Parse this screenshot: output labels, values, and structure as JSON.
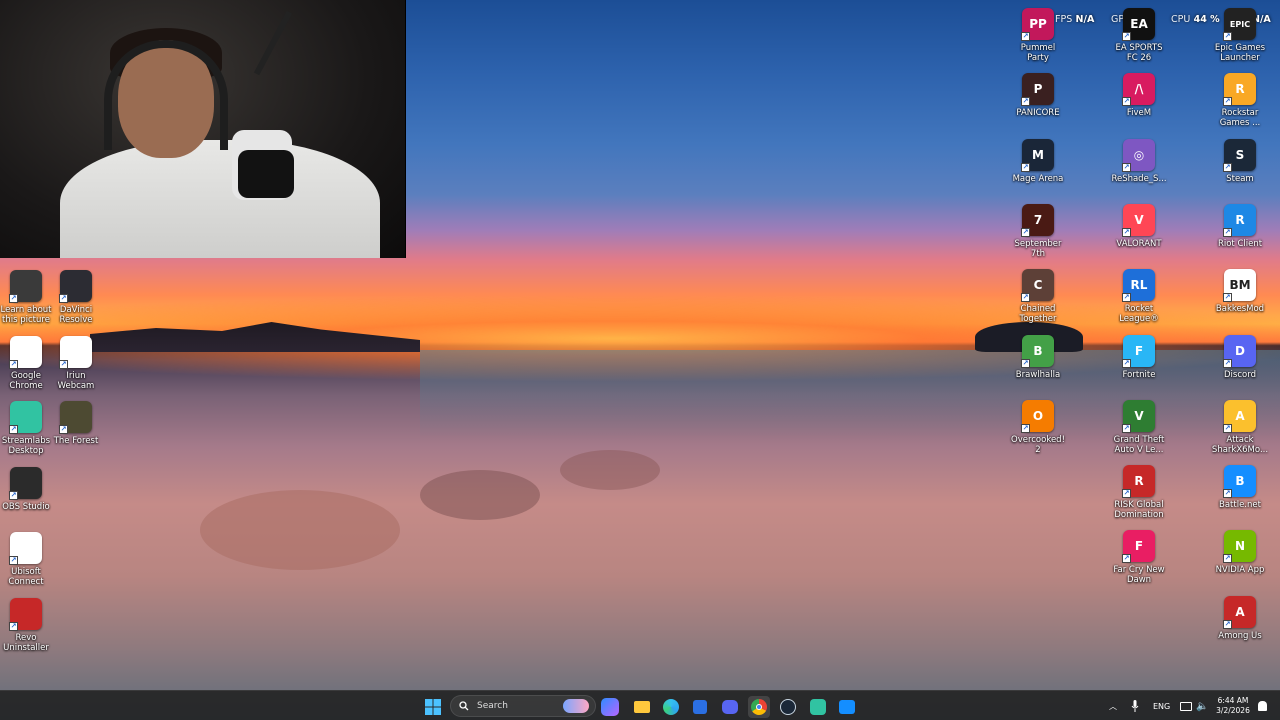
{
  "overlay": {
    "fps_label": "FPS",
    "fps_value": "N/A",
    "gpu_label": "GPU",
    "gpu_value": "%",
    "cpu_label": "CPU",
    "cpu_value": "44 %",
    "extra_value": "N/A"
  },
  "desktop_left": [
    {
      "label": "Learn about\nthis picture",
      "icon": "info-icon",
      "color": "#3a3a3a"
    },
    {
      "label": "DaVinci\nResolve",
      "icon": "davinci-icon",
      "color": "#2c2c33"
    },
    {
      "label": "Google\nChrome",
      "icon": "chrome-icon",
      "color": "#ffffff"
    },
    {
      "label": "Iriun\nWebcam",
      "icon": "webcam-icon",
      "color": "#ffffff"
    },
    {
      "label": "Streamlabs\nDesktop",
      "icon": "streamlabs-icon",
      "color": "#31c3a2"
    },
    {
      "label": "The Forest",
      "icon": "forest-icon",
      "color": "#4d4a32"
    },
    {
      "label": "OBS Studio",
      "icon": "obs-icon",
      "color": "#2b2b2b"
    },
    {
      "label": "Ubisoft\nConnect",
      "icon": "ubisoft-icon",
      "color": "#ffffff"
    },
    {
      "label": "Revo\nUninstaller",
      "icon": "revo-icon",
      "color": "#c62828"
    }
  ],
  "desktop_right": [
    {
      "label": "Pummel\nParty",
      "icon": "pummel-icon",
      "color": "#c2185b",
      "glyph": "PP"
    },
    {
      "label": "EA SPORTS\nFC 26",
      "icon": "ea-icon",
      "color": "#111111",
      "glyph": "EA"
    },
    {
      "label": "Epic Games\nLauncher",
      "icon": "epic-icon",
      "color": "#222222",
      "glyph": "EPIC"
    },
    {
      "label": "PANICORE",
      "icon": "panicore-icon",
      "color": "#3a2020",
      "glyph": "P"
    },
    {
      "label": "FiveM",
      "icon": "fivem-icon",
      "color": "#d81b60",
      "glyph": "/\\"
    },
    {
      "label": "Rockstar\nGames ...",
      "icon": "rockstar-icon",
      "color": "#f9a825",
      "glyph": "R"
    },
    {
      "label": "Mage Arena",
      "icon": "mage-arena-icon",
      "color": "#1a2638",
      "glyph": "M"
    },
    {
      "label": "ReShade_S...",
      "icon": "reshade-icon",
      "color": "#7e57c2",
      "glyph": "◎"
    },
    {
      "label": "Steam",
      "icon": "steam-icon",
      "color": "#1b2838",
      "glyph": "S"
    },
    {
      "label": "September\n7th",
      "icon": "september-icon",
      "color": "#4a1a14",
      "glyph": "7"
    },
    {
      "label": "VALORANT",
      "icon": "valorant-icon",
      "color": "#ff4655",
      "glyph": "V"
    },
    {
      "label": "Riot Client",
      "icon": "riot-icon",
      "color": "#1e88e5",
      "glyph": "R"
    },
    {
      "label": "Chained\nTogether",
      "icon": "chained-icon",
      "color": "#5d4037",
      "glyph": "C"
    },
    {
      "label": "Rocket\nLeague®",
      "icon": "rocket-league-icon",
      "color": "#1e6fd9",
      "glyph": "RL"
    },
    {
      "label": "BakkesMod",
      "icon": "bakkesmod-icon",
      "color": "#ffffff",
      "glyph": "BM"
    },
    {
      "label": "Brawlhalla",
      "icon": "brawlhalla-icon",
      "color": "#43a047",
      "glyph": "B"
    },
    {
      "label": "Fortnite",
      "icon": "fortnite-icon",
      "color": "#29b6f6",
      "glyph": "F"
    },
    {
      "label": "Discord",
      "icon": "discord-icon",
      "color": "#5865f2",
      "glyph": "D"
    },
    {
      "label": "Overcooked!\n2",
      "icon": "overcooked-icon",
      "color": "#f57c00",
      "glyph": "O"
    },
    {
      "label": "Grand Theft\nAuto V Le...",
      "icon": "gta-icon",
      "color": "#2e7d32",
      "glyph": "V"
    },
    {
      "label": "Attack\nSharkX6Mo...",
      "icon": "attack-shark-icon",
      "color": "#fbc02d",
      "glyph": "A"
    },
    {
      "label": "RISK Global\nDomination",
      "icon": "risk-icon",
      "color": "#c62828",
      "glyph": "R"
    },
    {
      "label": "Battle.net",
      "icon": "battlenet-icon",
      "color": "#148eff",
      "glyph": "B"
    },
    {
      "label": "Far Cry New\nDawn",
      "icon": "farcry-icon",
      "color": "#e91e63",
      "glyph": "F"
    },
    {
      "label": "NVIDIA App",
      "icon": "nvidia-icon",
      "color": "#76b900",
      "glyph": "N"
    },
    {
      "label": "Among Us",
      "icon": "among-us-icon",
      "color": "#c62828",
      "glyph": "A"
    }
  ],
  "taskbar": {
    "search_placeholder": "Search",
    "language": "ENG",
    "time": "6:44 AM",
    "date": "3/2/2026"
  }
}
